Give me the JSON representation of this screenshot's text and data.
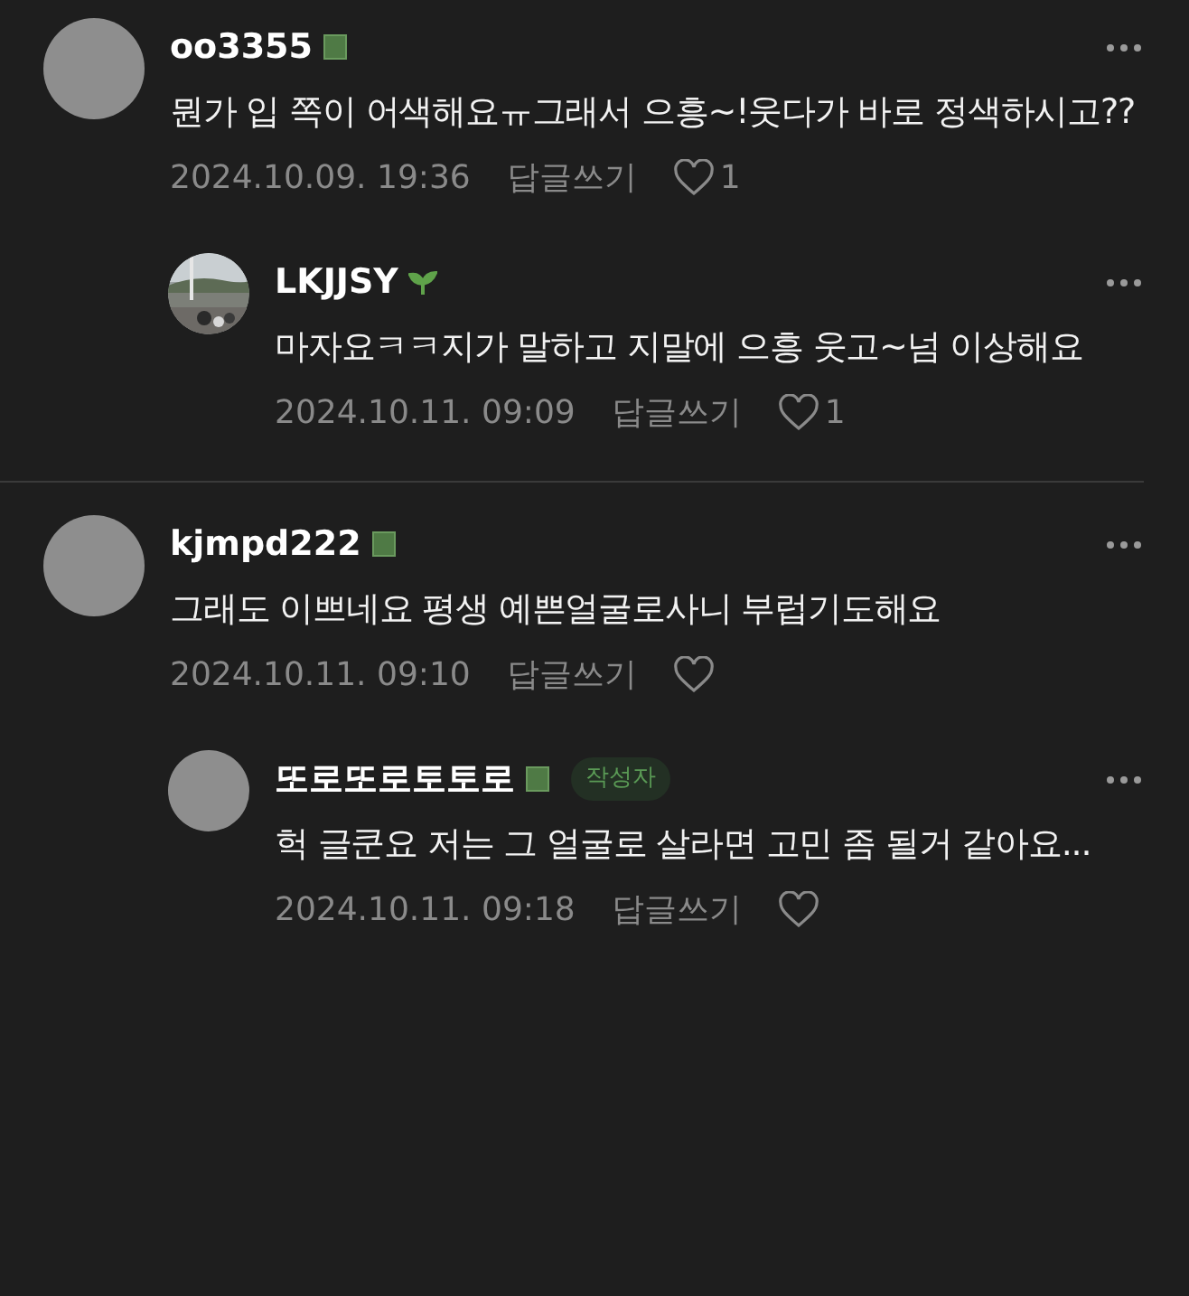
{
  "threads": [
    {
      "comment": {
        "avatar": {
          "kind": "plain"
        },
        "author": "oo3355",
        "badge": {
          "kind": "level"
        },
        "text": "뭔가 입 쪽이 어색해요ㅠ그래서 으흥~!웃다가 바로 정색하시고??",
        "date": "2024.10.09. 19:36",
        "reply_label": "답글쓰기",
        "likes": "1"
      },
      "replies": [
        {
          "author": "LKJJSY",
          "badge": {
            "kind": "sprout"
          },
          "text": "마자요ㅋㅋ지가 말하고 지말에 으흥 웃고~넘 이상해요",
          "date": "2024.10.11. 09:09",
          "reply_label": "답글쓰기",
          "likes": "1"
        }
      ]
    },
    {
      "comment": {
        "avatar": {
          "kind": "plain"
        },
        "author": "kjmpd222",
        "badge": {
          "kind": "level"
        },
        "text": "그래도 이쁘네요 평생 예쁜얼굴로사니 부럽기도해요",
        "date": "2024.10.11. 09:10",
        "reply_label": "답글쓰기"
      },
      "replies": [
        {
          "avatar": {
            "kind": "plain"
          },
          "author": "또로또로토토로",
          "badge": {
            "kind": "level"
          },
          "author_tag": "작성자",
          "text": "헉 글쿤요 저는 그 얼굴로 살라면 고민 좀 될거 같아요...",
          "date": "2024.10.11. 09:18",
          "reply_label": "답글쓰기"
        }
      ]
    }
  ]
}
